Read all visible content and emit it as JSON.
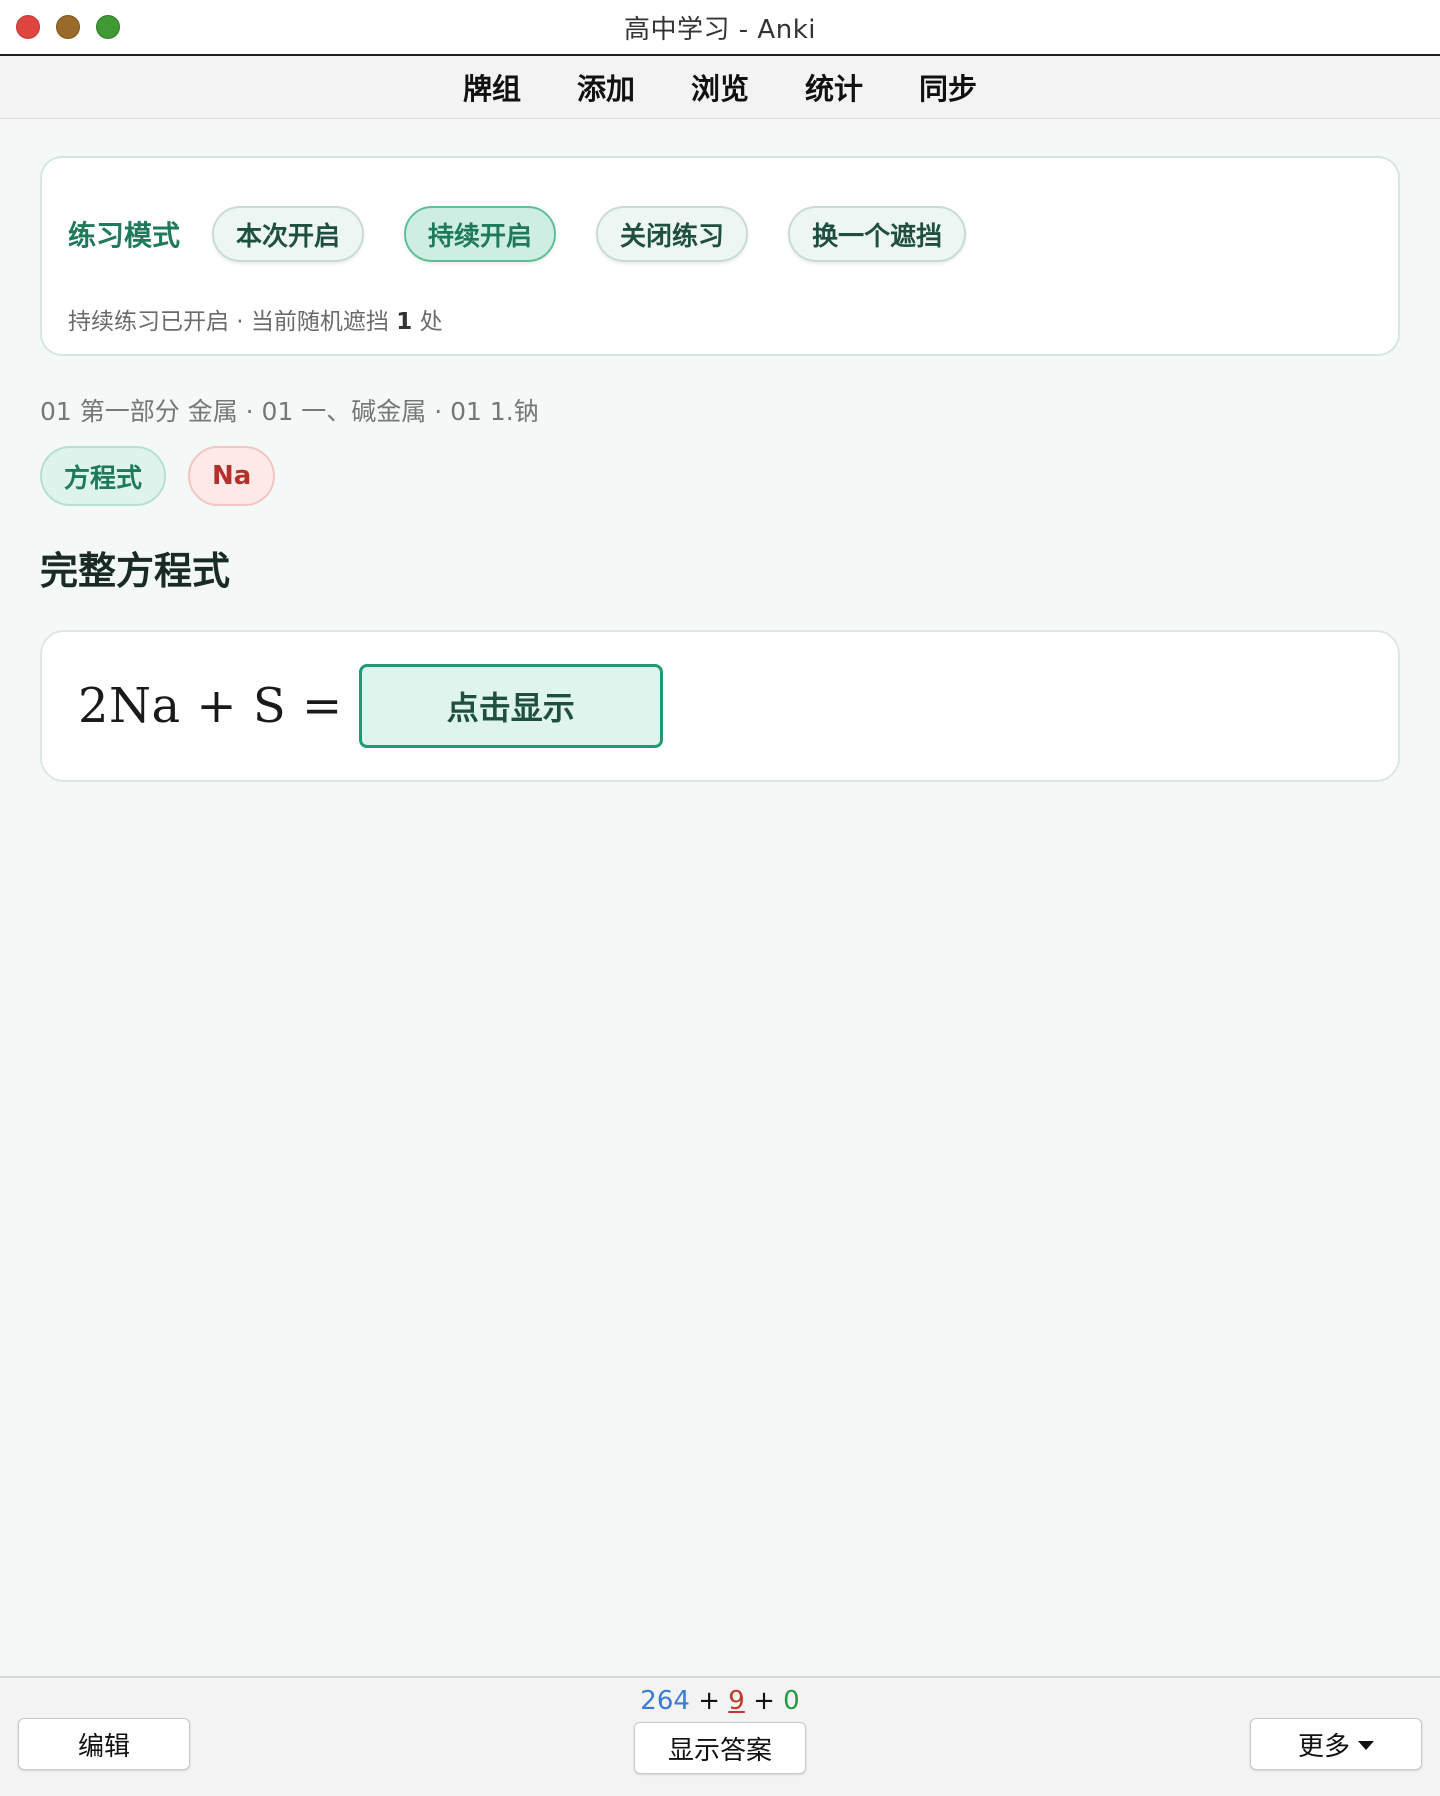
{
  "window": {
    "title": "高中学习 - Anki"
  },
  "menu": {
    "items": [
      "牌组",
      "添加",
      "浏览",
      "统计",
      "同步"
    ]
  },
  "practice": {
    "label": "练习模式",
    "buttons": [
      "本次开启",
      "持续开启",
      "关闭练习",
      "换一个遮挡"
    ],
    "active_button": "持续开启",
    "status_prefix": "持续练习已开启 · 当前随机遮挡 ",
    "status_count": "1",
    "status_suffix": " 处"
  },
  "breadcrumb": "01 第一部分 金属 · 01 一、碱金属 · 01 1.钠",
  "tags": [
    "方程式",
    "Na"
  ],
  "section_title": "完整方程式",
  "equation": {
    "left": "2Na + S =",
    "reveal_label": "点击显示"
  },
  "bottom": {
    "edit_label": "编辑",
    "show_answer_label": "显示答案",
    "more_label": "更多",
    "counts": {
      "new": "264",
      "learn": "9",
      "review": "0",
      "sep": "+"
    }
  },
  "colors": {
    "accent": "#1f7a5a",
    "reveal_border": "#1f9a74",
    "new_count": "#3a7bd5",
    "learn_count": "#c0392b",
    "review_count": "#1e9e40"
  }
}
